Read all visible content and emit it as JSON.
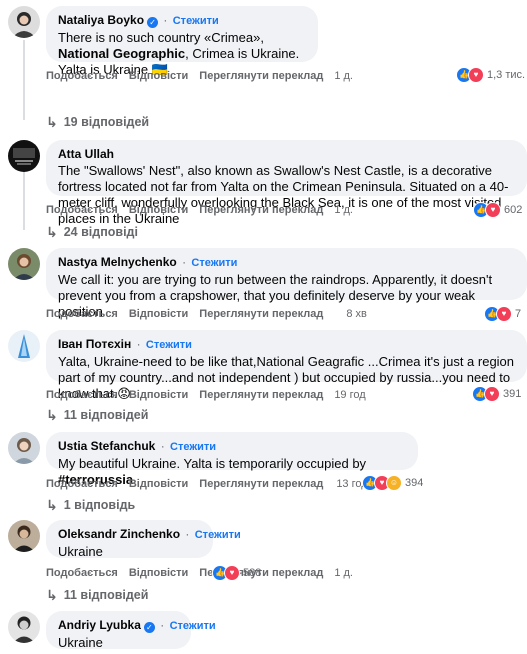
{
  "labels": {
    "like": "Подобається",
    "reply": "Відповісти",
    "translate": "Переглянути переклад",
    "follow": "Стежити",
    "dot": "·"
  },
  "comments": [
    {
      "author": "Nataliya Boyko",
      "verified": true,
      "text_pre": "There is no such country «Crimea», ",
      "text_bold": "National Geographic",
      "text_post": ", Crimea is Ukraine. Yalta is Ukraine 🇺🇦",
      "time": "1 д.",
      "reactions": "1,3 тис.",
      "replies": "19 відповідей"
    },
    {
      "author": "Atta Ullah",
      "verified": false,
      "text": "The \"Swallows' Nest\", also known as Swallow's Nest Castle, is a decorative fortress located not far from Yalta on the Crimean Peninsula. Situated on a 40-meter cliff, wonderfully overlooking the Black Sea, it is one of the most visited places in the Ukraine",
      "time": "1 д.",
      "reactions": "602",
      "replies": "24 відповіді"
    },
    {
      "author": "Nastya Melnychenko",
      "verified": false,
      "text": "We call it: you are trying to run between the raindrops. Apparently, it doesn't prevent you from a crapshower, that you definitely deserve by your weak position",
      "time": "8 хв",
      "reactions": "7"
    },
    {
      "author": "Іван Потєхін",
      "verified": false,
      "text": "Yalta, Ukraine-need to be like that,National Geagrafic ...Crimea it's just a region part of my country...and not independent ) but occupied by russia...you need to know that.😡",
      "time": "19 год",
      "reactions": "391",
      "replies": "11 відповідей"
    },
    {
      "author": "Ustia Stefanchuk",
      "verified": false,
      "text_pre": "My beautiful Ukraine. Yalta is temporarily occupied by ",
      "text_bold": "#terrorussia",
      "time": "13 год",
      "reactions": "394",
      "replies": "1 відповідь"
    },
    {
      "author": "Oleksandr Zinchenko",
      "verified": false,
      "text": "Ukraine",
      "time": "1 д.",
      "reactions": "588",
      "replies": "11 відповідей"
    },
    {
      "author": "Andriy Lyubka",
      "verified": true,
      "text": "Ukraine"
    }
  ],
  "colors": {
    "accent": "#1877f2",
    "bubble": "#f0f2f5",
    "muted": "#65676b"
  }
}
